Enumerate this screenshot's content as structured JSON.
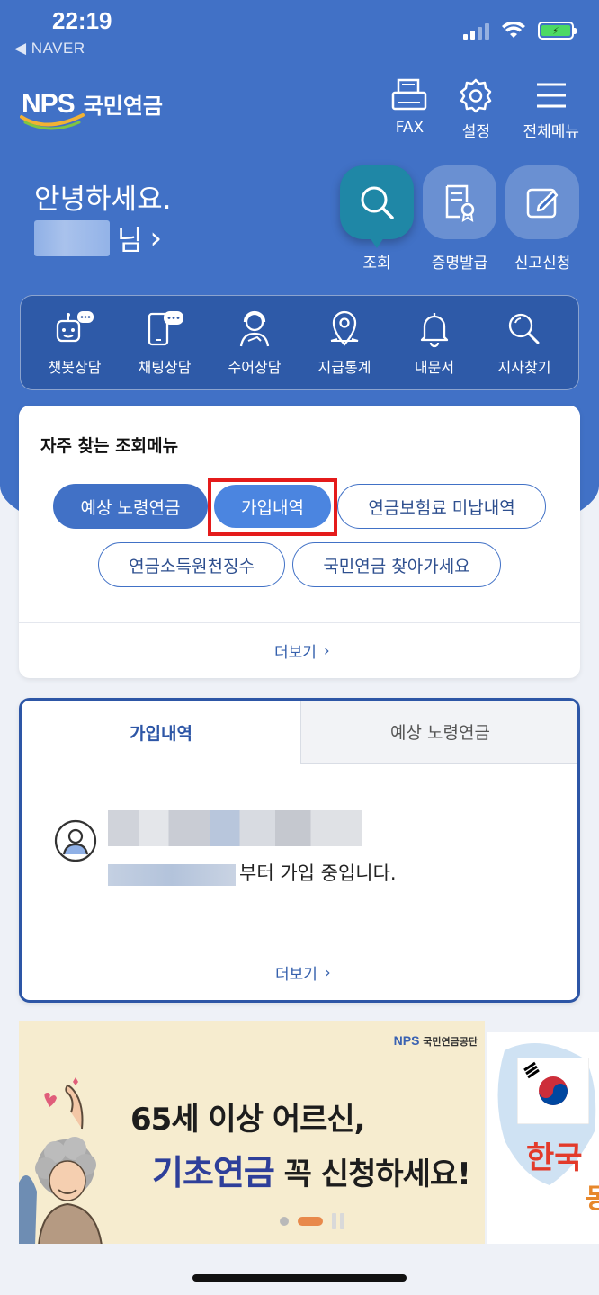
{
  "status_bar": {
    "time": "22:19",
    "back_app": "◀ NAVER"
  },
  "header": {
    "logo_mark": "NPS",
    "logo_text": "국민연금",
    "actions": [
      {
        "label": "FAX",
        "icon": "fax-icon"
      },
      {
        "label": "설정",
        "icon": "gear-icon"
      },
      {
        "label": "전체메뉴",
        "icon": "menu-icon"
      }
    ]
  },
  "greeting": {
    "hello": "안녕하세요.",
    "suffix": "님",
    "chevron": "›"
  },
  "quick_actions": [
    {
      "label": "조회",
      "icon": "search-icon",
      "active": true
    },
    {
      "label": "증명발급",
      "icon": "certificate-icon",
      "active": false
    },
    {
      "label": "신고신청",
      "icon": "edit-icon",
      "active": false
    }
  ],
  "services": [
    {
      "label": "챗봇상담",
      "icon": "chatbot-icon"
    },
    {
      "label": "채팅상담",
      "icon": "chat-phone-icon"
    },
    {
      "label": "수어상담",
      "icon": "sign-language-icon"
    },
    {
      "label": "지급통계",
      "icon": "location-pin-icon"
    },
    {
      "label": "내문서",
      "icon": "bell-icon"
    },
    {
      "label": "지사찾기",
      "icon": "magnifier-icon"
    }
  ],
  "frequent_menu": {
    "title": "자주 찾는 조회메뉴",
    "pills": [
      "예상 노령연금",
      "가입내역",
      "연금보험료 미납내역",
      "연금소득원천징수",
      "국민연금 찾아가세요"
    ],
    "more": "더보기"
  },
  "tab_card": {
    "tabs": [
      "가입내역",
      "예상 노령연금"
    ],
    "join_text": "부터 가입 중입니다.",
    "more": "더보기"
  },
  "banner": {
    "logo_mark": "NPS",
    "logo_text": "국민연금공단",
    "line1": "65세 이상 어르신,",
    "line2_accent": "기초연금",
    "line2_rest": " 꼭 신청하세요!"
  },
  "banner2": {
    "text1": "한국",
    "text2": "동"
  },
  "colors": {
    "primary": "#4171c6",
    "dark_primary": "#2d56a6",
    "highlight": "#e41b1b",
    "banner_bg": "#f6eccf"
  }
}
